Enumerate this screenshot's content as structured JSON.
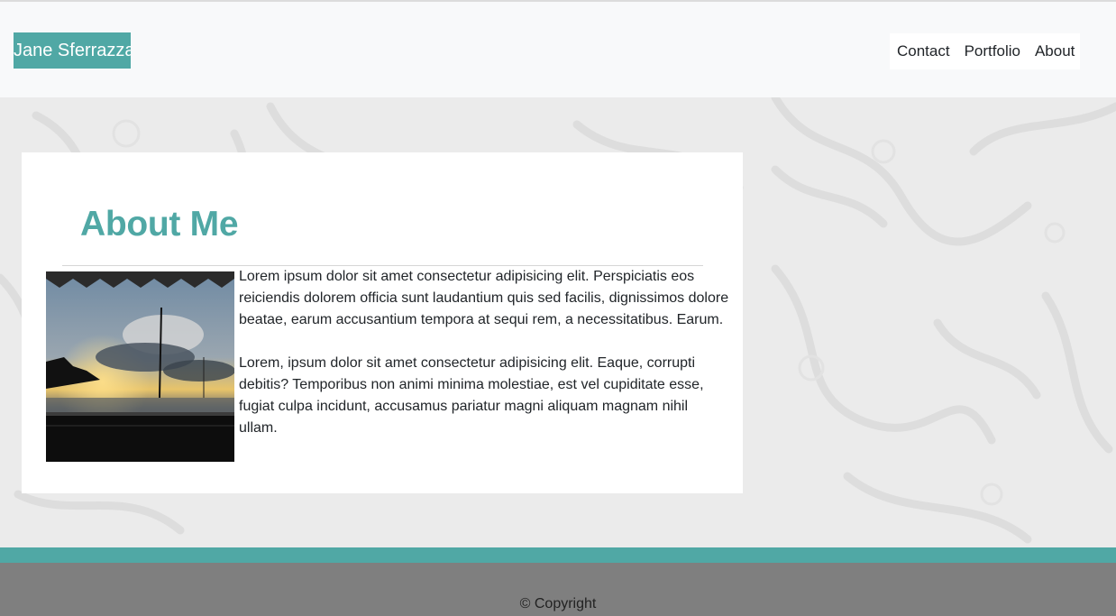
{
  "colors": {
    "accent": "#50a8a5",
    "navbar_bg": "#f8f9fa",
    "footer_bg": "#7f7f7f",
    "page_bg": "#ebebeb"
  },
  "header": {
    "brand": "Jane Sferrazza",
    "nav": [
      "Contact",
      "Portfolio",
      "About"
    ]
  },
  "main": {
    "title": "About Me",
    "image_description_icon": "sunset-harbor-photo",
    "paragraphs": [
      "Lorem ipsum dolor sit amet consectetur adipisicing elit. Perspiciatis eos reiciendis dolorem officia sunt laudantium quis sed facilis, dignissimos dolore beatae, earum accusantium tempora at sequi rem, a necessitatibus. Earum.",
      "Lorem, ipsum dolor sit amet consectetur adipisicing elit. Eaque, corrupti debitis? Temporibus non animi minima molestiae, est vel cupiditate esse, fugiat culpa incidunt, accusamus pariatur magni aliquam magnam nihil ullam."
    ]
  },
  "footer": {
    "copyright": "© Copyright"
  }
}
